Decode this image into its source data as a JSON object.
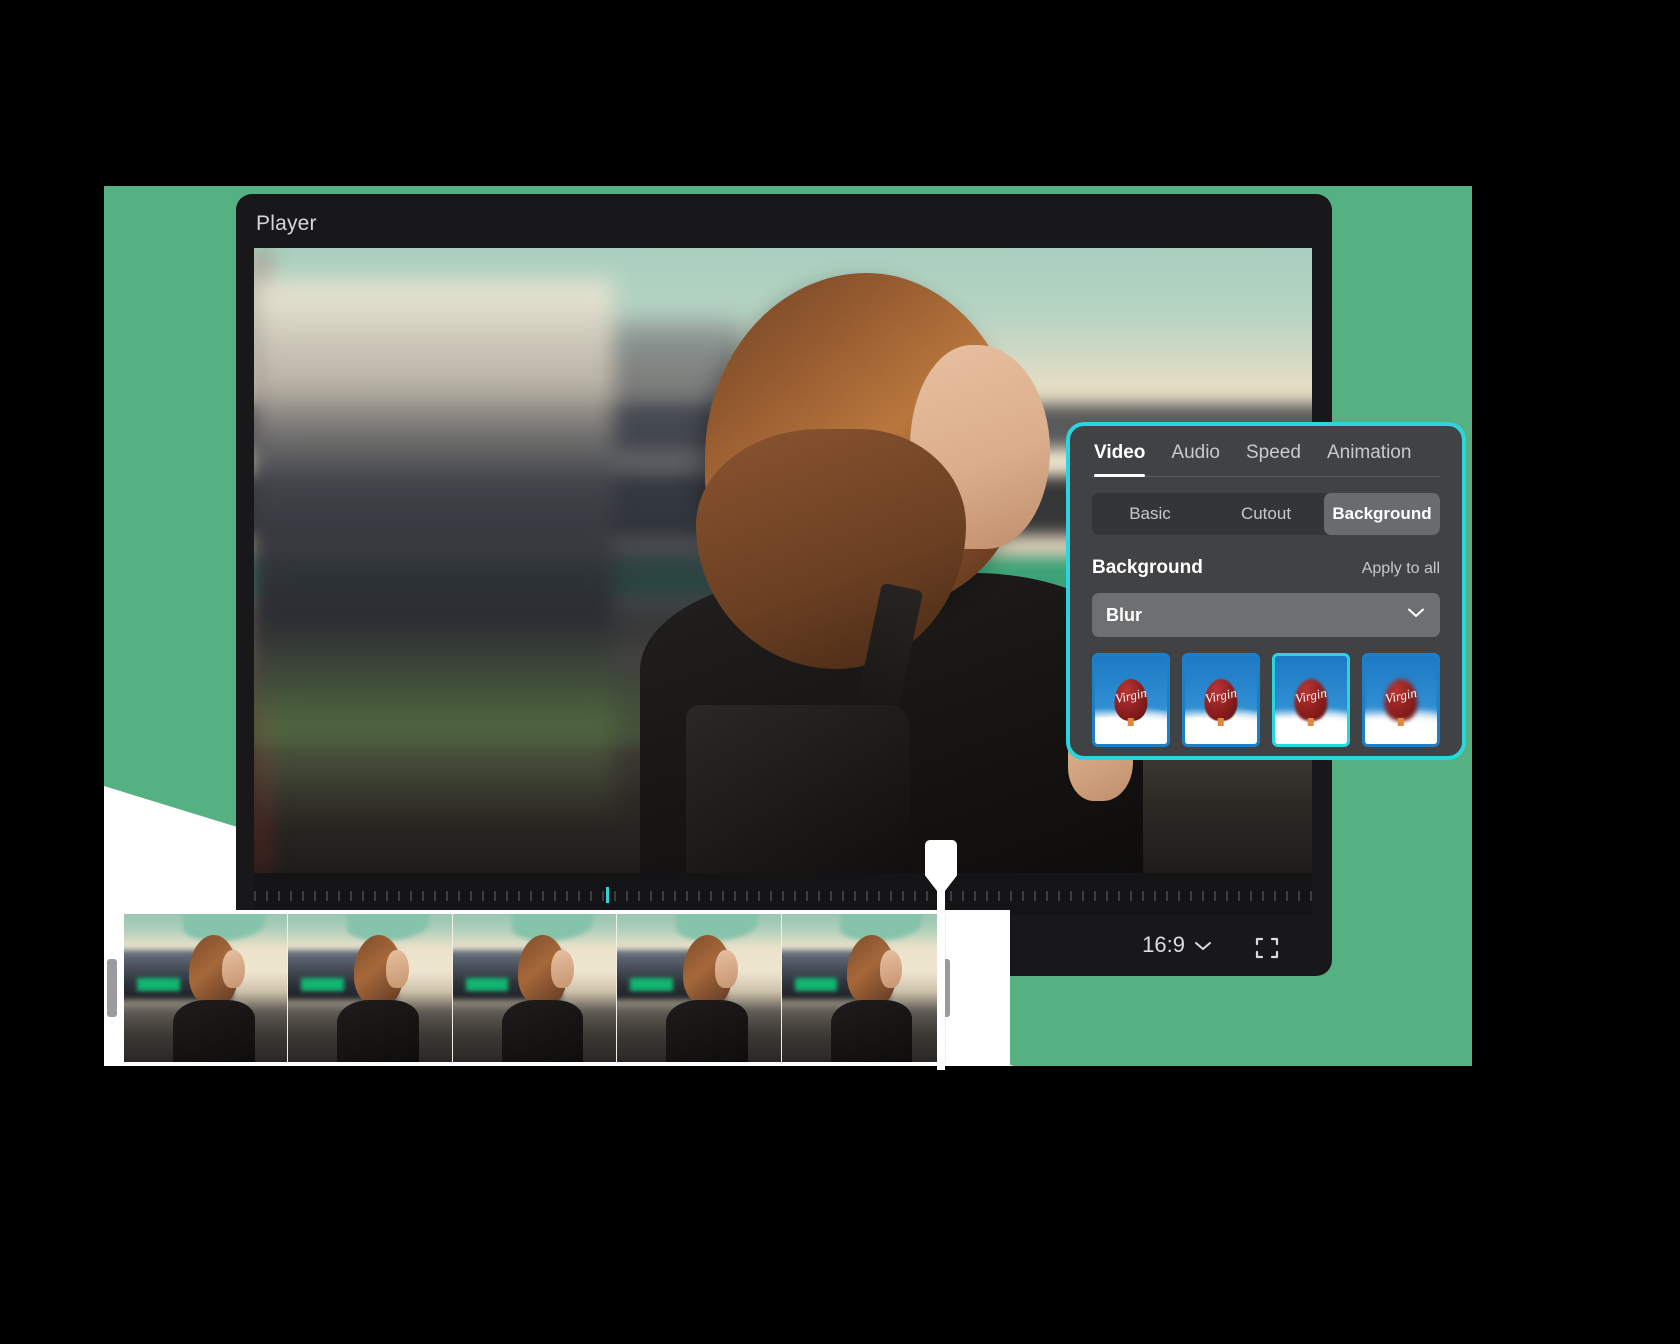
{
  "colors": {
    "backdrop_green": "#55b181",
    "panel_accent_cyan": "#2ad5e0",
    "window_dark": "#18181a",
    "panel_gray": "#414244",
    "playhead_cyan": "#2fd4d4"
  },
  "player": {
    "title": "Player",
    "aspect_ratio": "16:9",
    "aspect_chevron_icon": "chevron-down-icon",
    "fullscreen_icon": "fullscreen-icon"
  },
  "timeline": {
    "playhead_icon": "playhead-marker",
    "trim_handle_left_icon": "trim-handle-left",
    "trim_handle_right_icon": "trim-handle-right",
    "frames": [
      {
        "label": "frame-1"
      },
      {
        "label": "frame-2"
      },
      {
        "label": "frame-3"
      },
      {
        "label": "frame-4"
      },
      {
        "label": "frame-5"
      }
    ]
  },
  "properties_panel": {
    "tabs": [
      {
        "label": "Video",
        "active": true
      },
      {
        "label": "Audio",
        "active": false
      },
      {
        "label": "Speed",
        "active": false
      },
      {
        "label": "Animation",
        "active": false
      }
    ],
    "segments": [
      {
        "label": "Basic",
        "active": false
      },
      {
        "label": "Cutout",
        "active": false
      },
      {
        "label": "Background",
        "active": true
      }
    ],
    "section": {
      "title": "Background",
      "apply_to_all": "Apply to all"
    },
    "dropdown": {
      "value": "Blur",
      "chevron_icon": "chevron-down-icon"
    },
    "thumbnails": [
      {
        "name": "blur-preset-1",
        "selected": false,
        "watermark": "Virgin"
      },
      {
        "name": "blur-preset-2",
        "selected": false,
        "watermark": "Virgin"
      },
      {
        "name": "blur-preset-3",
        "selected": true,
        "watermark": "Virgin"
      },
      {
        "name": "blur-preset-4",
        "selected": false,
        "watermark": "Virgin"
      }
    ]
  }
}
